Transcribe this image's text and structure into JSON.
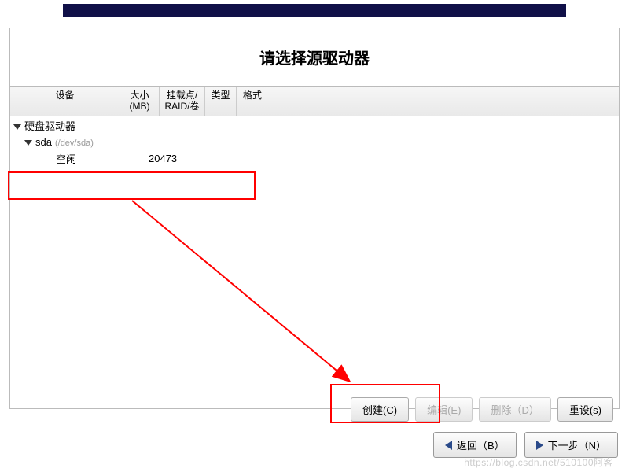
{
  "title": "请选择源驱动器",
  "columns": {
    "device": "设备",
    "size": "大小\n(MB)",
    "mount": "挂载点/\nRAID/卷",
    "type": "类型",
    "format": "格式"
  },
  "tree": {
    "root": "硬盘驱动器",
    "disk": "sda",
    "disk_detail": "(/dev/sda)",
    "free_label": "空闲",
    "free_size": "20473"
  },
  "buttons": {
    "create": "创建(C)",
    "edit": "编辑(E)",
    "delete": "删除（D）",
    "reset": "重设(s)"
  },
  "nav": {
    "back": "返回（B）",
    "next": "下一步（N）"
  },
  "watermark": "https://blog.csdn.net/510100阿客"
}
